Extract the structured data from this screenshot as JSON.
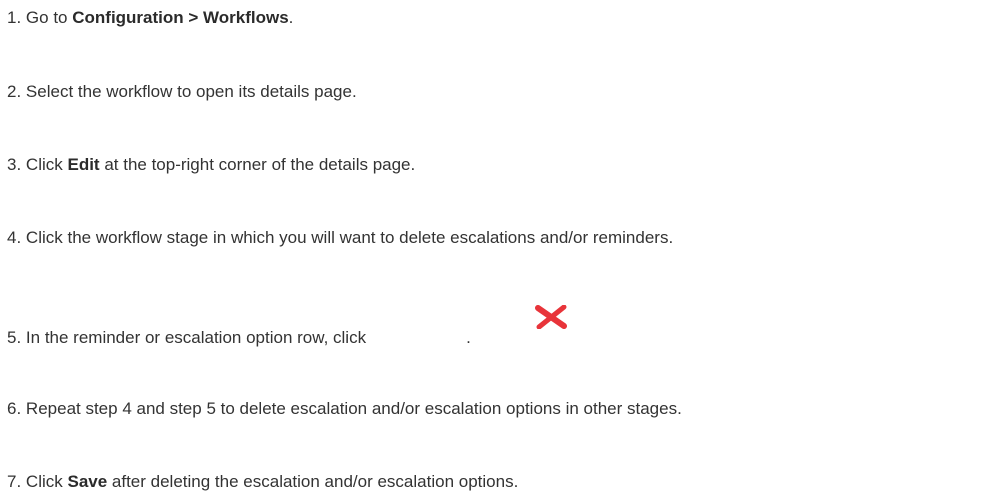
{
  "steps": [
    {
      "num": "1.",
      "pre": "Go to ",
      "bold1": "Configuration > Workflows",
      "post": "."
    },
    {
      "num": "2.",
      "text": "Select the workflow to open its details page."
    },
    {
      "num": "3.",
      "pre": "Click ",
      "bold": "Edit",
      "post": " at the top-right corner of the details page."
    },
    {
      "num": "4.",
      "text": "Click the workflow stage in which you will want to delete escalations and/or reminders."
    },
    {
      "num": "5.",
      "pre": "In the reminder or escalation option row, click",
      "post": "."
    },
    {
      "num": "6.",
      "text": "Repeat step 4 and step 5 to delete escalation and/or escalation options in other stages."
    },
    {
      "num": "7.",
      "pre": "Click ",
      "bold": "Save",
      "post": " after deleting the escalation and/or escalation options."
    }
  ],
  "icons": {
    "delete": {
      "name": "delete-x-icon",
      "color": "#e8343a"
    }
  }
}
